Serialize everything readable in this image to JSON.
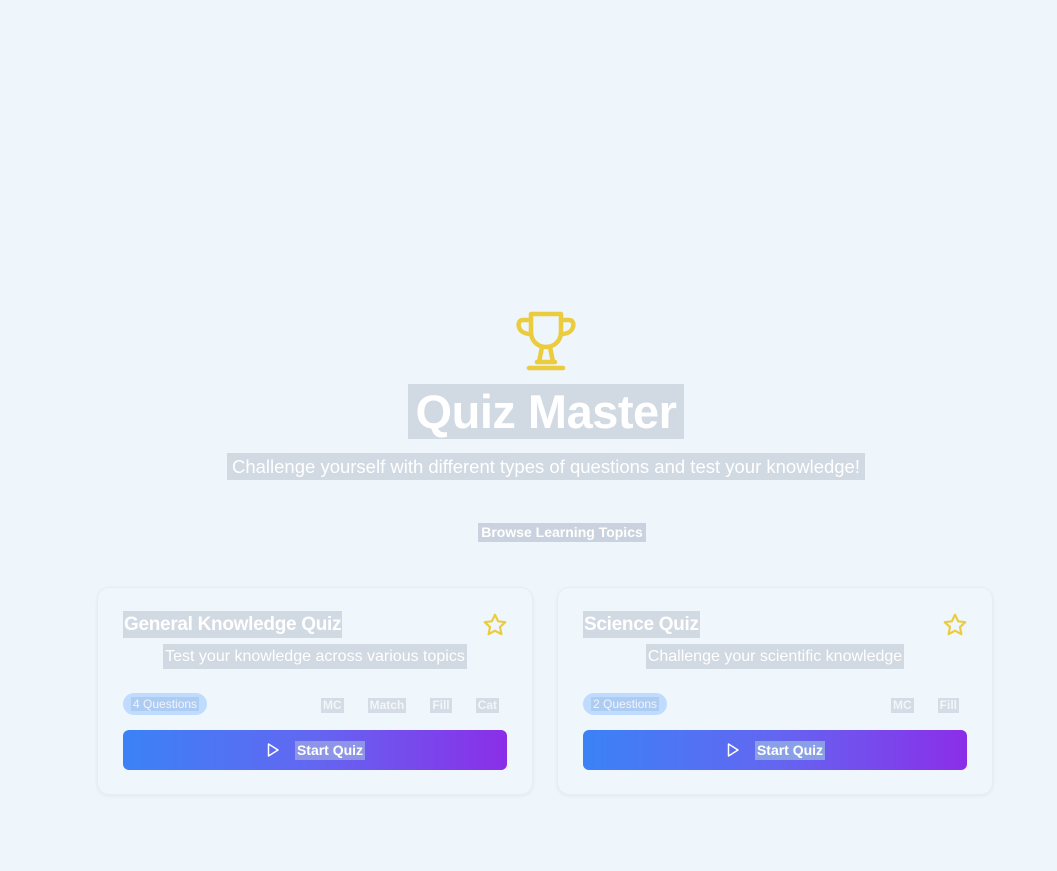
{
  "hero": {
    "icon": "trophy-icon",
    "title": "Quiz Master",
    "subtitle": "Challenge yourself with different types of questions and test your knowledge!",
    "browse_link": "Browse Learning Topics"
  },
  "colors": {
    "background": "#eef5fb",
    "trophy": "#eacc3e",
    "button_gradient_start": "#3b82f6",
    "button_gradient_end": "#8b2ee8",
    "badge": "#bfdbfe",
    "star": "#eacc3e"
  },
  "quizzes": [
    {
      "title": "General Knowledge Quiz",
      "description": "Test your knowledge across various topics",
      "question_count": "4 Questions",
      "tags": [
        "MC",
        "Match",
        "Fill",
        "Cat"
      ],
      "favorite_icon": "star-icon",
      "start_label": "Start Quiz",
      "start_icon": "play-icon"
    },
    {
      "title": "Science Quiz",
      "description": "Challenge your scientific knowledge",
      "question_count": "2 Questions",
      "tags": [
        "MC",
        "Fill"
      ],
      "favorite_icon": "star-icon",
      "start_label": "Start Quiz",
      "start_icon": "play-icon"
    }
  ]
}
